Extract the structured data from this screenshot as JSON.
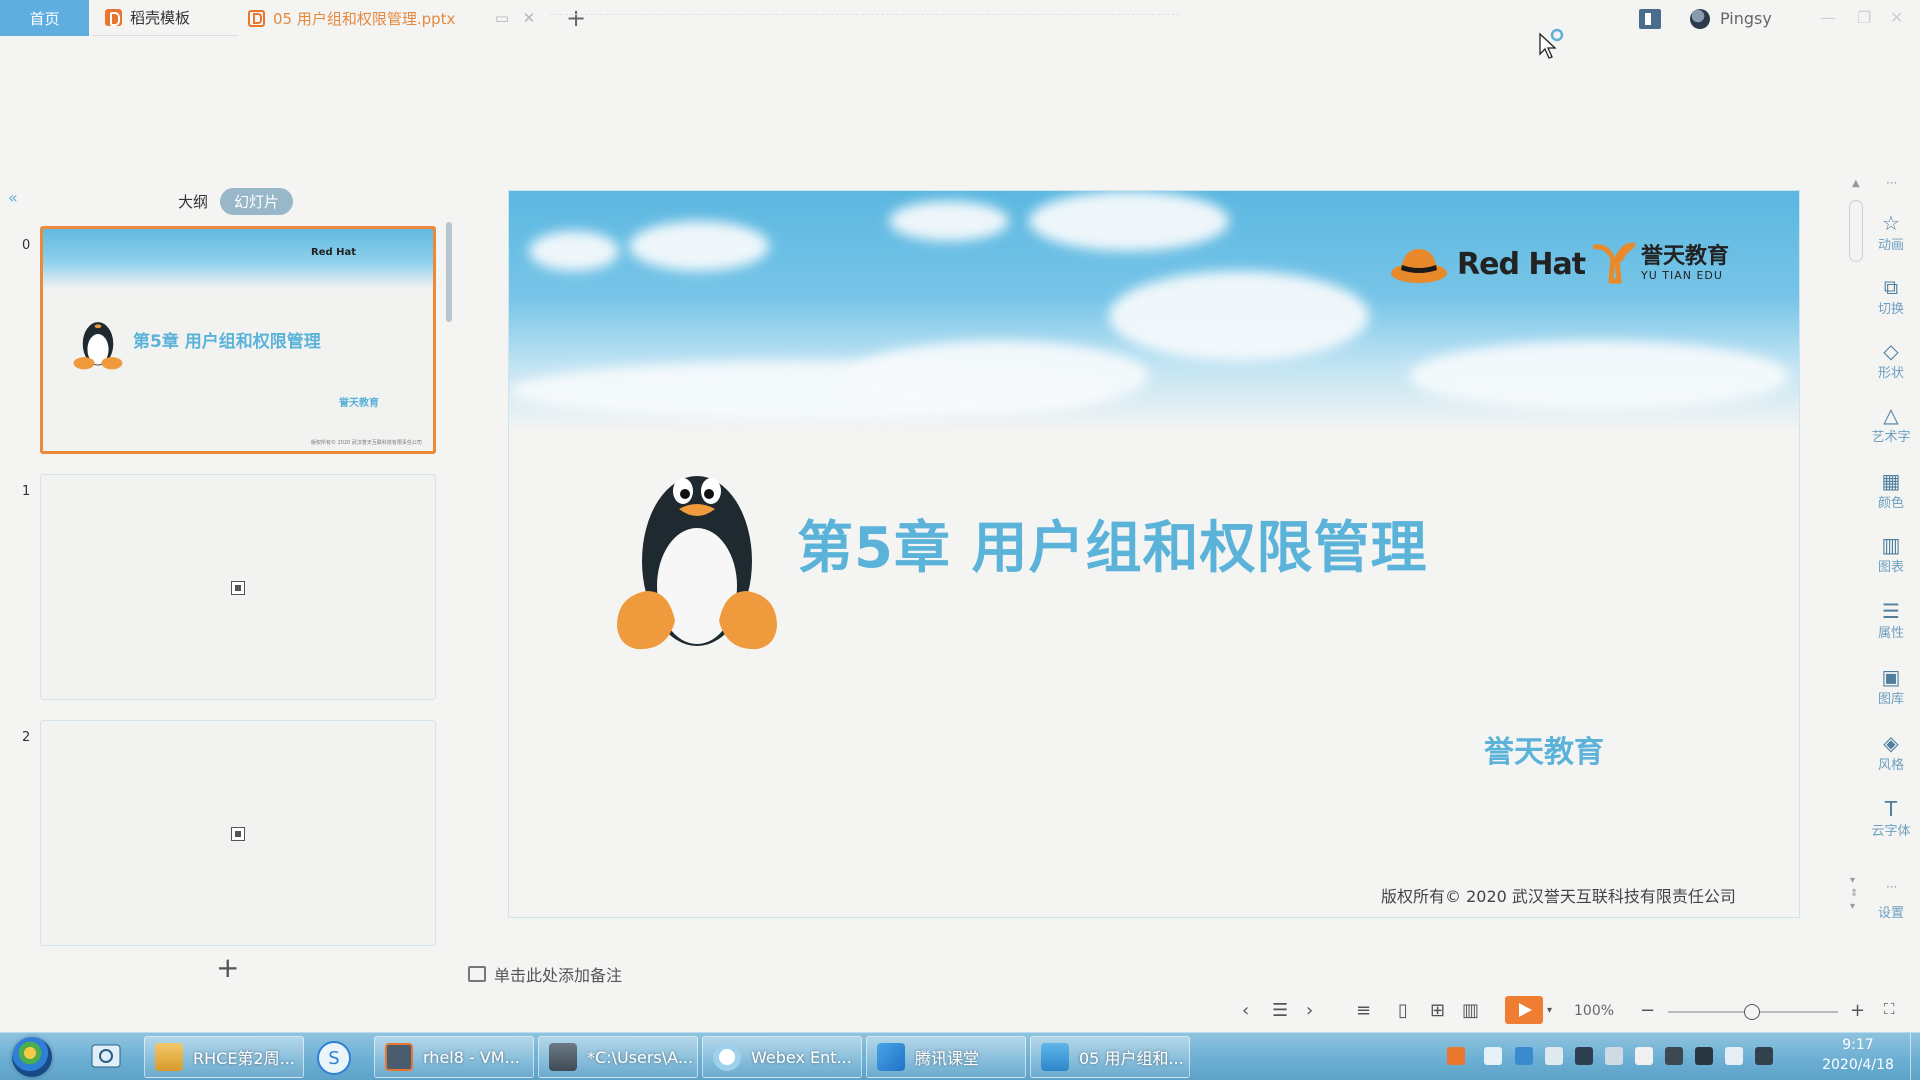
{
  "tabs": {
    "home": "首页",
    "template": "稻壳模板",
    "document": "05 用户组和权限管理.pptx"
  },
  "user": {
    "name": "Pingsy"
  },
  "panel": {
    "outline_tab": "大纲",
    "slides_tab": "幻灯片",
    "collapse": "«",
    "slide_numbers": [
      "0",
      "1",
      "2"
    ]
  },
  "thumb0": {
    "title": "第5章  用户组和权限管理",
    "brand": "誉天教育",
    "logo": "Red Hat",
    "copyright": "版权所有© 2020 武汉誉天互联科技有限责任公司"
  },
  "slide": {
    "logo_redhat": "Red Hat",
    "logo_yutian_cn": "誉天教育",
    "logo_yutian_en": "YU TIAN EDU",
    "title": "第5章  用户组和权限管理",
    "brand": "誉天教育",
    "copyright": "版权所有© 2020 武汉誉天互联科技有限责任公司"
  },
  "notes": {
    "placeholder": "单击此处添加备注"
  },
  "right_tools": [
    {
      "label": "动画",
      "icon": "star-icon"
    },
    {
      "label": "切换",
      "icon": "transition-icon"
    },
    {
      "label": "形状",
      "icon": "shape-icon"
    },
    {
      "label": "艺术字",
      "icon": "art-text-icon"
    },
    {
      "label": "颜色",
      "icon": "color-icon"
    },
    {
      "label": "图表",
      "icon": "chart-icon"
    },
    {
      "label": "属性",
      "icon": "properties-icon"
    },
    {
      "label": "图库",
      "icon": "gallery-icon"
    },
    {
      "label": "风格",
      "icon": "style-icon"
    },
    {
      "label": "云字体",
      "icon": "font-icon"
    },
    {
      "label": "设置",
      "icon": "settings-icon"
    }
  ],
  "statusbar": {
    "zoom": "100%"
  },
  "taskbar": {
    "tasks": [
      "RHCE第2周...",
      "rhel8 - VM...",
      "*C:\\Users\\A...",
      "Webex Ent...",
      "腾讯课堂",
      "05 用户组和..."
    ],
    "time": "9:17",
    "date": "2020/4/18"
  },
  "colors": {
    "accent_blue": "#5cb3da",
    "accent_orange": "#ea8a3a",
    "home_tab": "#5eaee0"
  }
}
